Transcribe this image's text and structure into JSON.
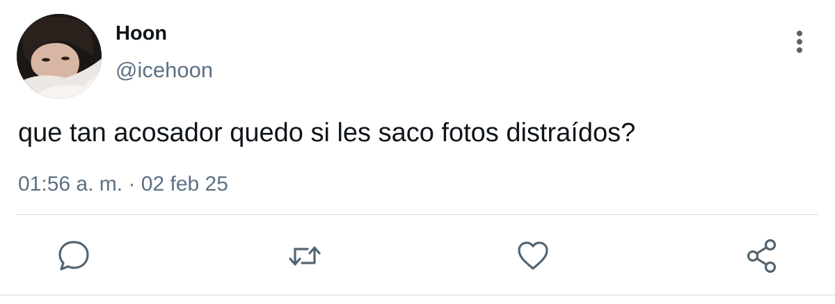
{
  "user": {
    "display_name": "Hoon",
    "handle": "@icehoon"
  },
  "tweet": {
    "text": "que tan acosador quedo si les saco fotos distraídos?",
    "time": "01:56 a. m.",
    "separator": "·",
    "date": "02 feb 25"
  },
  "actions": {
    "reply_icon": "reply-icon",
    "retweet_icon": "retweet-icon",
    "like_icon": "heart-icon",
    "share_icon": "share-icon"
  },
  "menu": {
    "icon": "more-vertical-icon"
  },
  "colors": {
    "text_primary": "#0f1419",
    "text_secondary": "#5b7083",
    "icon": "#536471",
    "divider": "#d6dde2"
  }
}
